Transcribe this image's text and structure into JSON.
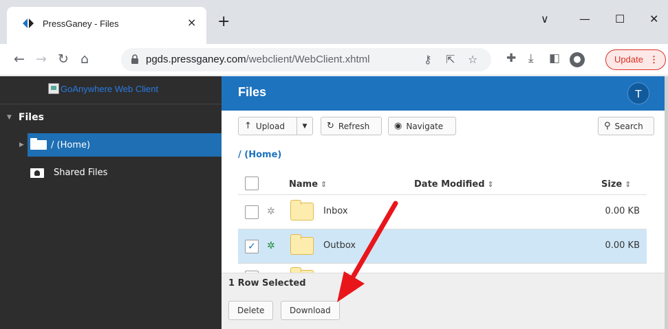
{
  "browser": {
    "tab_title": "PressGaney - Files",
    "tab_close": "×",
    "new_tab": "+",
    "window_controls": {
      "dropdown": "∨",
      "minimize": "—",
      "maximize": "☐",
      "close": "✕"
    },
    "url_host": "pgds.pressganey.com",
    "url_path": "/webclient/WebClient.xhtml",
    "update_label": "Update",
    "update_menu": "⋮"
  },
  "sidebar": {
    "logo_alt": "GoAnywhere Web Client",
    "section_label": "Files",
    "items": [
      {
        "label": "/ (Home)",
        "selected": true
      },
      {
        "label": "Shared Files",
        "selected": false
      }
    ]
  },
  "header": {
    "title": "Files",
    "avatar_initial": "T"
  },
  "toolbar": {
    "upload_label": "Upload",
    "refresh_label": "Refresh",
    "navigate_label": "Navigate",
    "search_label": "Search"
  },
  "breadcrumb": "/ (Home)",
  "table": {
    "columns": {
      "name": "Name",
      "date_modified": "Date Modified",
      "size": "Size"
    },
    "rows": [
      {
        "name": "Inbox",
        "date_modified": "",
        "size": "0.00 KB",
        "selected": false
      },
      {
        "name": "Outbox",
        "date_modified": "",
        "size": "0.00 KB",
        "selected": true
      }
    ]
  },
  "footer": {
    "selection_text": "1 Row Selected",
    "delete_label": "Delete",
    "download_label": "Download"
  },
  "colors": {
    "header_blue": "#1e73be",
    "sidebar_dark": "#2d2d2d",
    "selected_row": "#cfe6f7",
    "annotation_arrow": "#e8161b"
  },
  "icons": {
    "favicon": "pressganey-logo-icon",
    "upload": "arrow-up-icon",
    "refresh": "refresh-icon",
    "navigate": "navigate-circle-icon",
    "search": "magnifier-icon",
    "folder": "folder-icon",
    "gear": "gear-icon"
  }
}
